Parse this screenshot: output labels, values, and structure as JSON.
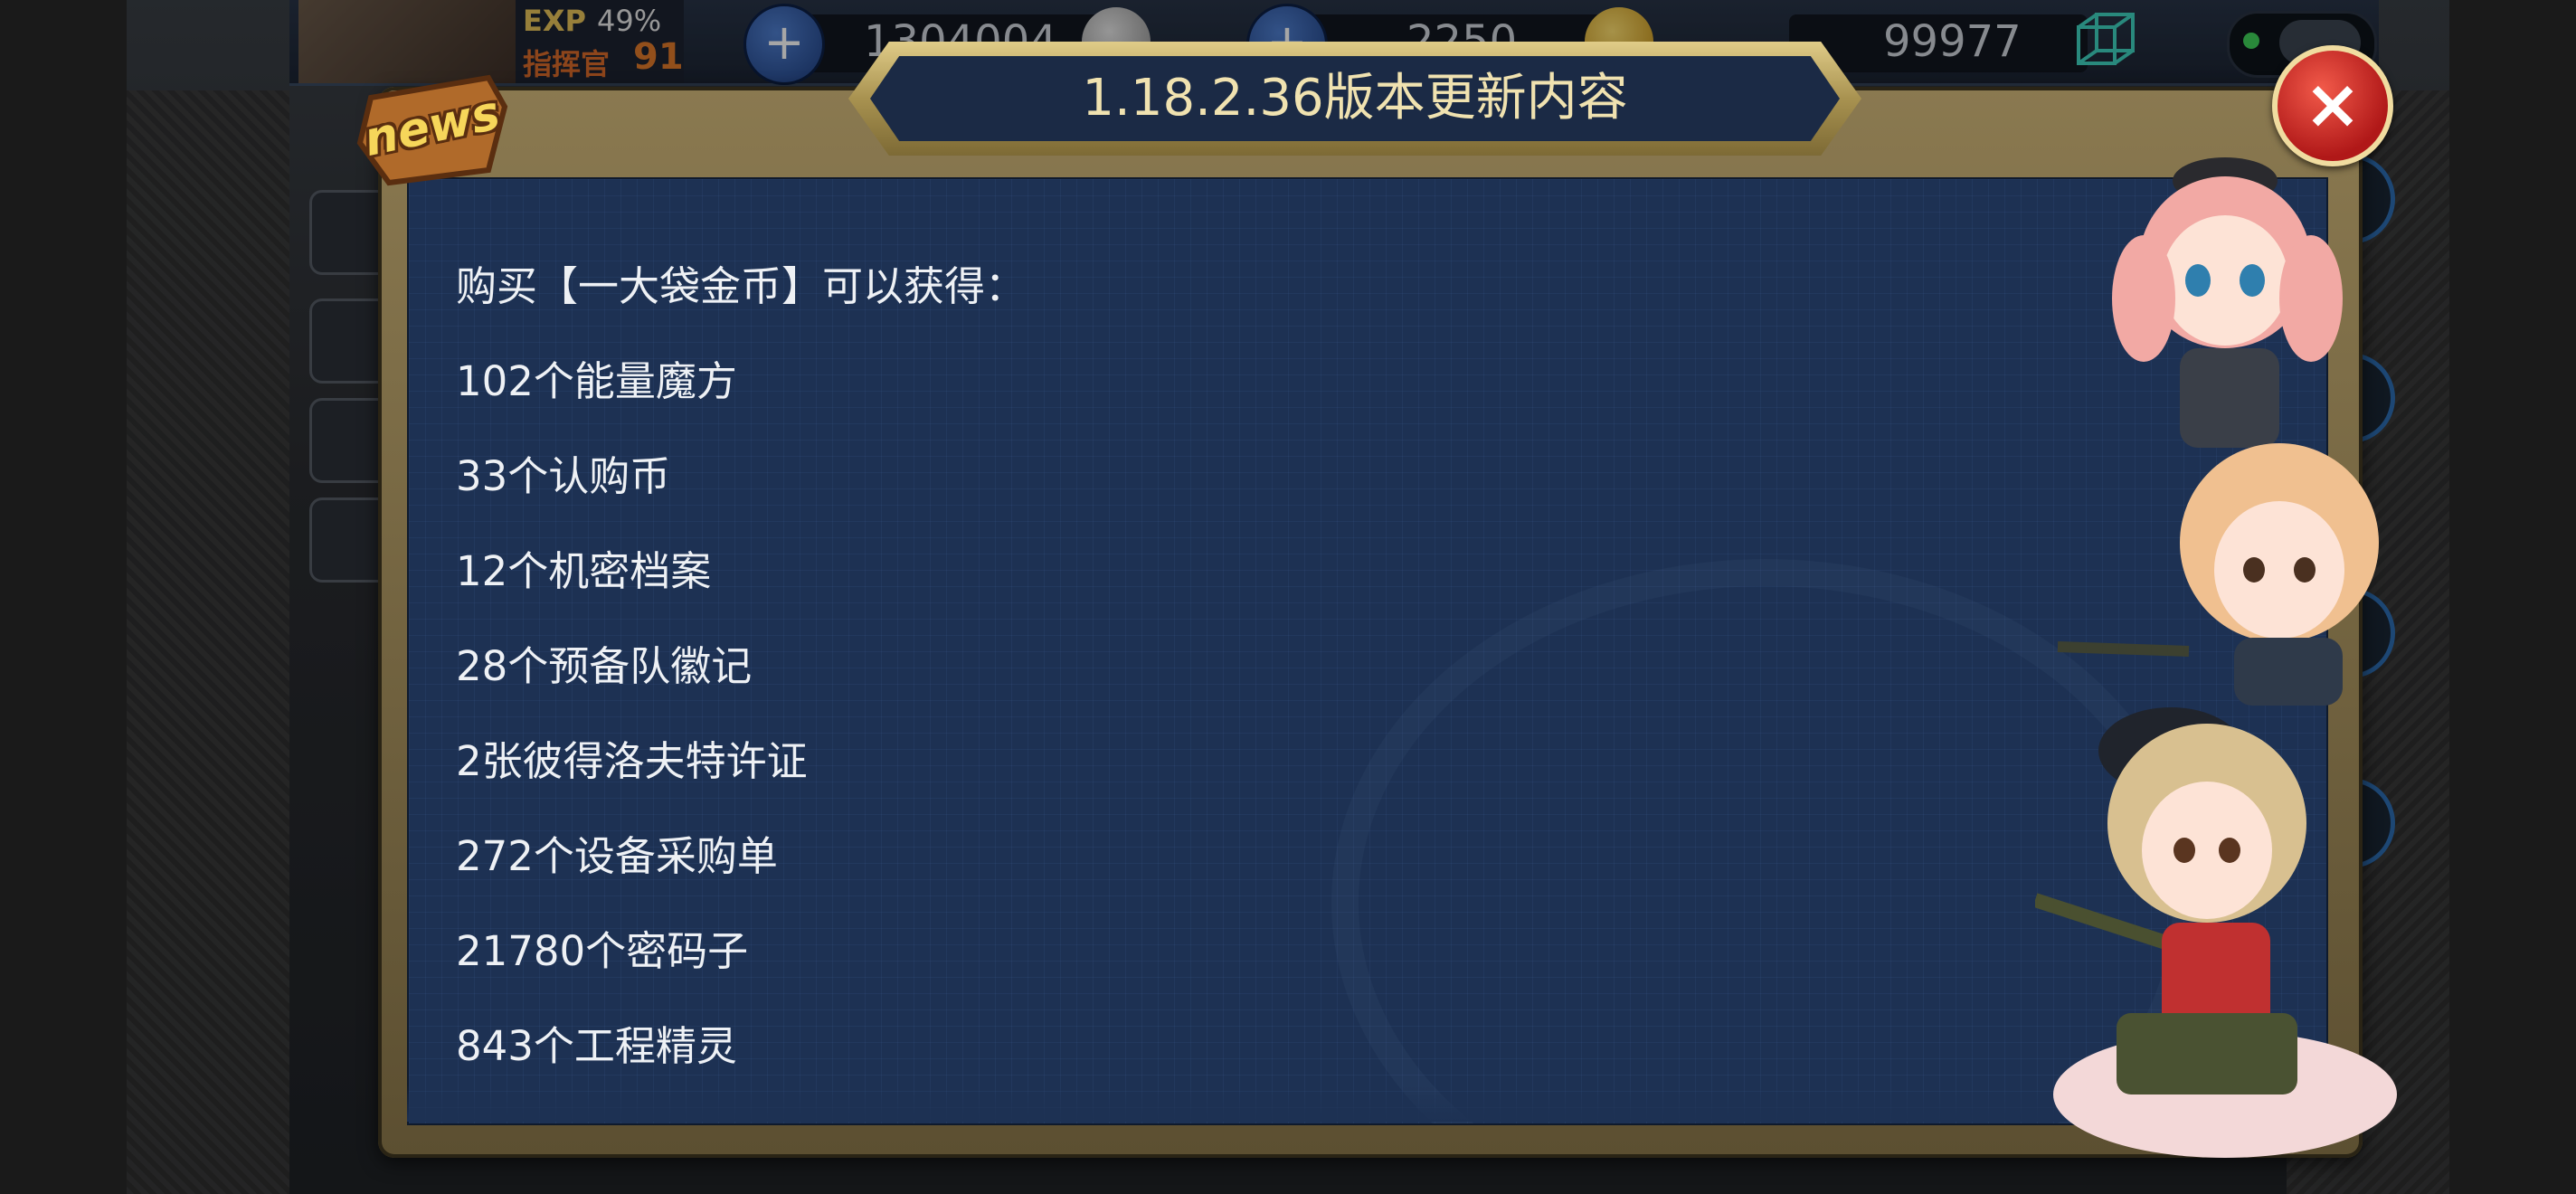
{
  "hud": {
    "exp_label": "EXP",
    "exp_percent": "49%",
    "rank_label": "指挥官",
    "rank_value": "91",
    "resource_1": "1304004",
    "resource_2": "2250",
    "resource_3": "99977"
  },
  "dialog": {
    "news_label": "news",
    "title": "1.18.2.36版本更新内容",
    "close_label": "×",
    "lines": [
      "购买【一大袋金币】可以获得：",
      "102个能量魔方",
      "33个认购币",
      "12个机密档案",
      "28个预备队徽记",
      "2张彼得洛夫特许证",
      "272个设备采购单",
      "21780个密码子",
      "843个工程精灵"
    ]
  },
  "colors": {
    "dialog_bg": "#1d3153",
    "frame_gold": "#8a7950",
    "close_red": "#d02020",
    "title_text": "#f0e2b0"
  }
}
